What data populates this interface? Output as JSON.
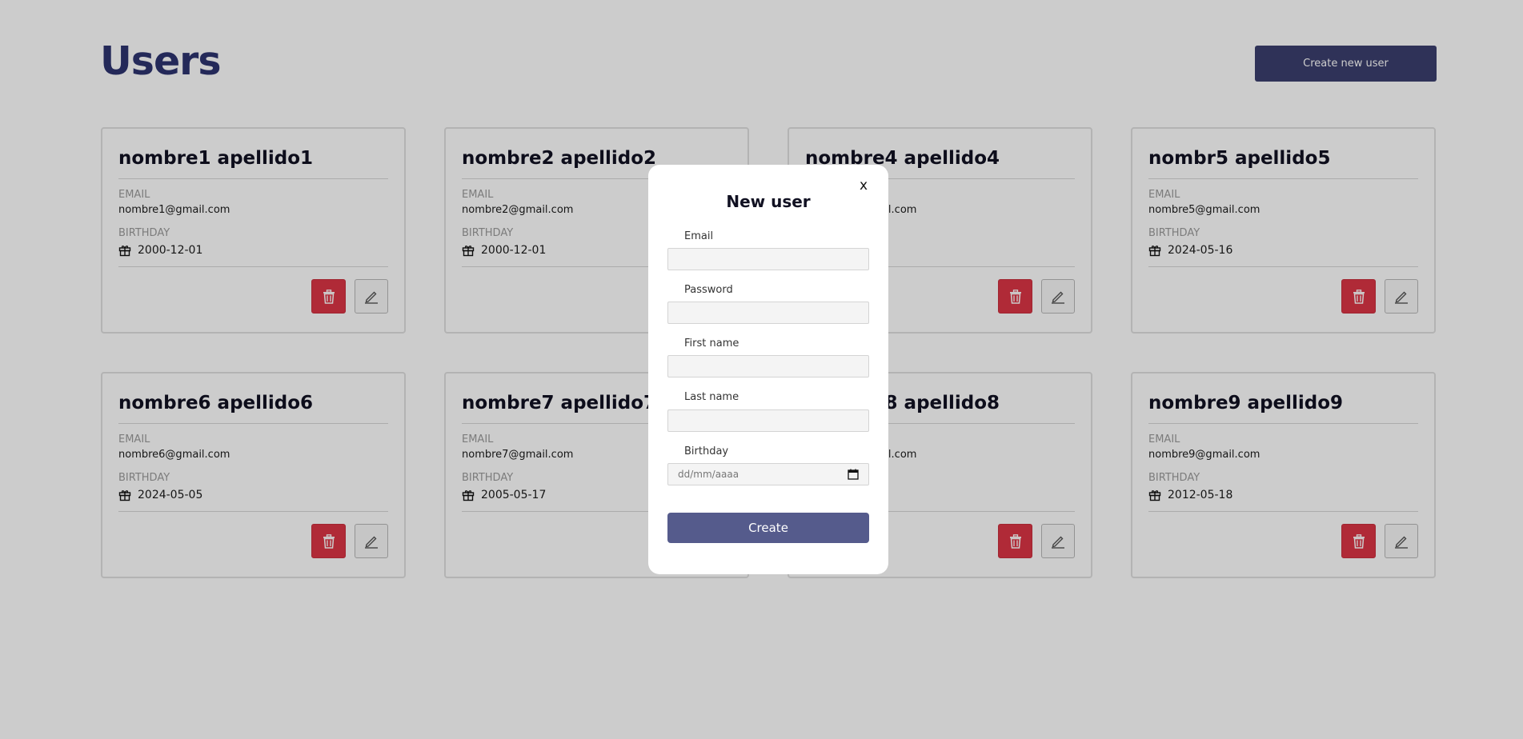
{
  "page": {
    "title": "Users",
    "create_button_label": "Create new user"
  },
  "labels": {
    "email": "EMAIL",
    "birthday": "BIRTHDAY"
  },
  "users": [
    {
      "name": "nombre1 apellido1",
      "email": "nombre1@gmail.com",
      "birthday": "2000-12-01"
    },
    {
      "name": "nombre2 apellido2",
      "email": "nombre2@gmail.com",
      "birthday": "2000-12-01"
    },
    {
      "name": "nombre4 apellido4",
      "email": "nombre4@gmail.com",
      "birthday": ""
    },
    {
      "name": "nombr5 apellido5",
      "email": "nombre5@gmail.com",
      "birthday": "2024-05-16"
    },
    {
      "name": "nombre6 apellido6",
      "email": "nombre6@gmail.com",
      "birthday": "2024-05-05"
    },
    {
      "name": "nombre7 apellido7",
      "email": "nombre7@gmail.com",
      "birthday": "2005-05-17"
    },
    {
      "name": "nombre8 apellido8",
      "email": "nombre8@gmail.com",
      "birthday": ""
    },
    {
      "name": "nombre9 apellido9",
      "email": "nombre9@gmail.com",
      "birthday": "2012-05-18"
    }
  ],
  "modal": {
    "title": "New user",
    "close_label": "x",
    "fields": {
      "email_label": "Email",
      "password_label": "Password",
      "first_name_label": "First name",
      "last_name_label": "Last name",
      "birthday_label": "Birthday",
      "birthday_placeholder": "dd/mm/aaaa"
    },
    "submit_label": "Create"
  },
  "colors": {
    "title": "#2d3470",
    "primary_button": "#3b3f6e",
    "modal_button": "#555b8c",
    "delete": "#dc3545"
  },
  "icons": {
    "delete": "trash-icon",
    "edit": "pencil-icon",
    "birthday": "gift-icon",
    "calendar": "calendar-icon"
  }
}
